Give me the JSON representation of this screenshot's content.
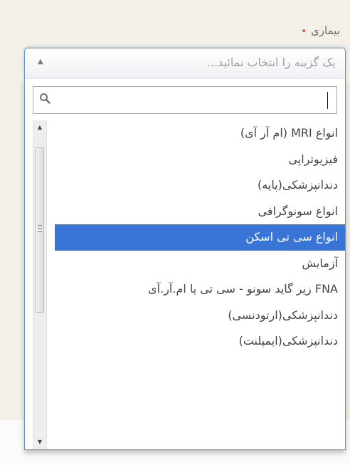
{
  "field": {
    "label": "بیماری",
    "required_mark": "•",
    "placeholder": "یک گزینه را انتخاب نمائید...",
    "arrow_icon": "triangle-up-icon"
  },
  "search": {
    "value": "",
    "icon": "search-icon"
  },
  "options": [
    "انواع MRI (ام آر آی)",
    "فیزیوتراپی",
    "دندانپزشکی(پایه)",
    "انواع سونوگرافی",
    "انواع سی تی اسکن",
    "آزمایش",
    "FNA زیر گاید سونو - سی تی یا ام.آر.آی",
    "دندانپزشکی(ارتودنسی)",
    "دندانپزشکی(ایمپلنت)"
  ],
  "highlighted_index": 4,
  "colors": {
    "highlight": "#3875d7",
    "border_focus": "#5d95cf",
    "required": "#e8422f",
    "background": "#f4f0e7"
  }
}
